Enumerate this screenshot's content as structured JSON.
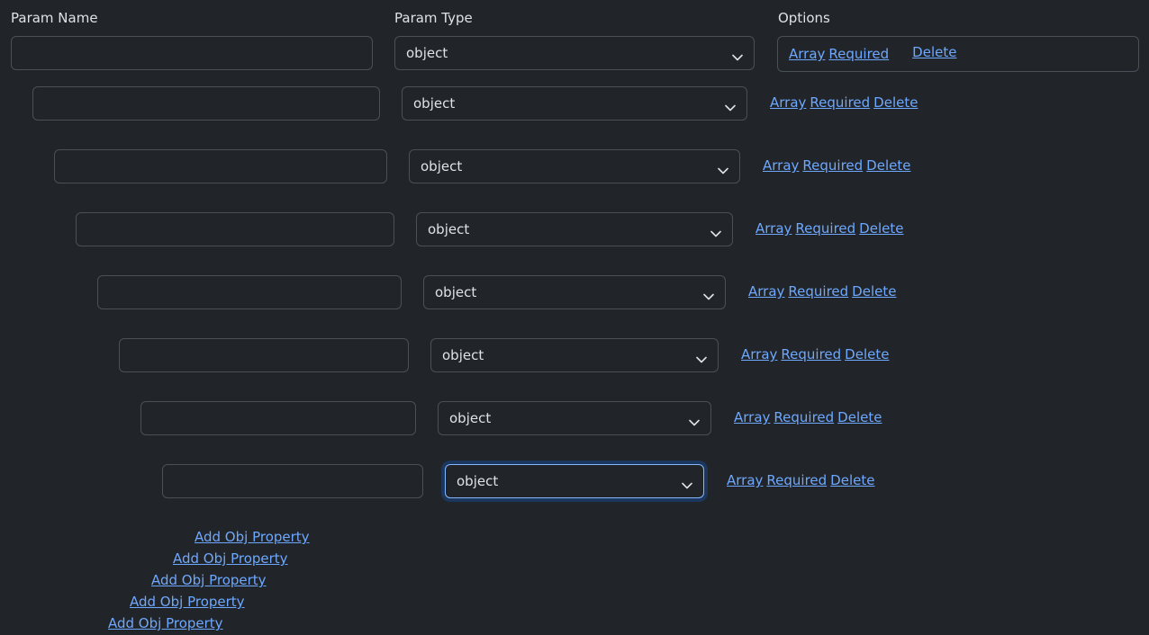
{
  "headers": {
    "param_name": "Param Name",
    "param_type": "Param Type",
    "options": "Options"
  },
  "rows": [
    {
      "name": "",
      "type": "object",
      "links": [
        "Array",
        "Required",
        "Delete"
      ]
    },
    {
      "name": "",
      "type": "object",
      "links": [
        "Array",
        "Required",
        "Delete"
      ]
    },
    {
      "name": "",
      "type": "object",
      "links": [
        "Array",
        "Required",
        "Delete"
      ]
    },
    {
      "name": "",
      "type": "object",
      "links": [
        "Array",
        "Required",
        "Delete"
      ]
    },
    {
      "name": "",
      "type": "object",
      "links": [
        "Array",
        "Required",
        "Delete"
      ]
    },
    {
      "name": "",
      "type": "object",
      "links": [
        "Array",
        "Required",
        "Delete"
      ]
    },
    {
      "name": "",
      "type": "object",
      "links": [
        "Array",
        "Required",
        "Delete"
      ]
    },
    {
      "name": "",
      "type": "object",
      "links": [
        "Array",
        "Required",
        "Delete"
      ],
      "focused": true
    }
  ],
  "add_links": [
    "Add Obj Property",
    "Add Obj Property",
    "Add Obj Property",
    "Add Obj Property",
    "Add Obj Property"
  ],
  "colors": {
    "background": "#212529",
    "link": "#6ea8fe",
    "border": "#495057",
    "focus": "#86b7fe"
  }
}
